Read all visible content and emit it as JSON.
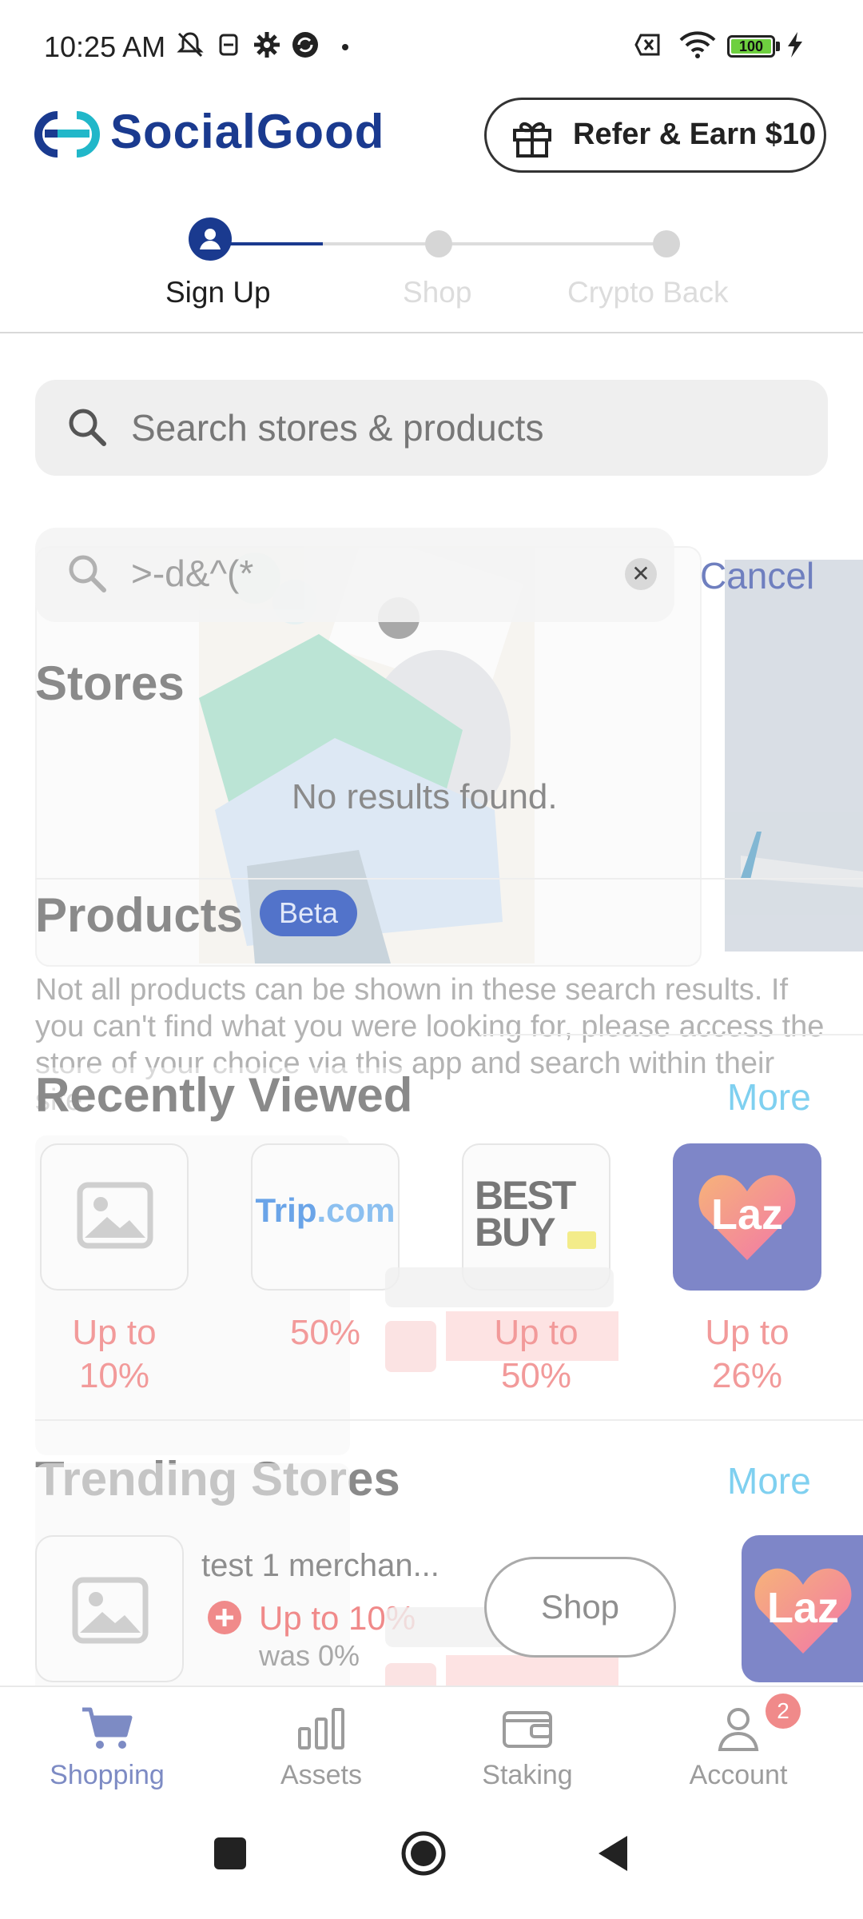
{
  "status_bar": {
    "time": "10:25 AM",
    "battery": "100"
  },
  "header": {
    "brand": "SocialGood",
    "refer_label": "Refer & Earn $10"
  },
  "stepper": {
    "steps": [
      "Sign Up",
      "Shop",
      "Crypto Back"
    ],
    "active_index": 0
  },
  "search": {
    "placeholder": "Search stores & products"
  },
  "overlay": {
    "query": ">-d&^(*",
    "cancel_label": "Cancel",
    "stores_title": "Stores",
    "empty_text": "No results found.",
    "products_title": "Products",
    "beta_label": "Beta",
    "products_note": "Not all products can be shown in these search results. If you can't find what you were looking for, please access the store of your choice via this app and search within their site."
  },
  "recently_viewed": {
    "title": "Recently Viewed",
    "more_label": "More",
    "items": [
      {
        "kind": "placeholder",
        "cashback": "Up to\n10%"
      },
      {
        "kind": "trip",
        "logo_text_a": "Trip",
        "logo_text_b": ".com",
        "cashback": "50%"
      },
      {
        "kind": "bestbuy",
        "logo_text_a": "BEST",
        "logo_text_b": "BUY",
        "cashback": "Up to\n50%"
      },
      {
        "kind": "laz",
        "logo_text_a": "Laz",
        "cashback": "Up to\n26%"
      }
    ]
  },
  "trending": {
    "title": "Trending Stores",
    "more_label": "More",
    "item": {
      "name": "test 1 merchan...",
      "cashback": "Up to 10%",
      "was": "was 0%",
      "shop_label": "Shop"
    },
    "next_logo": "Laz"
  },
  "bottom_nav": {
    "items": [
      {
        "label": "Shopping",
        "icon": "cart-icon",
        "active": true
      },
      {
        "label": "Assets",
        "icon": "bar-chart-icon",
        "active": false
      },
      {
        "label": "Staking",
        "icon": "wallet-icon",
        "active": false
      },
      {
        "label": "Account",
        "icon": "person-icon",
        "active": false,
        "badge": "2"
      }
    ]
  },
  "colors": {
    "brand_navy": "#1a3a8f",
    "brand_teal": "#21b7c9",
    "link_blue": "#7fd0f0",
    "cashback_red": "#f29a9a",
    "active_nav": "#7d8bc4"
  }
}
